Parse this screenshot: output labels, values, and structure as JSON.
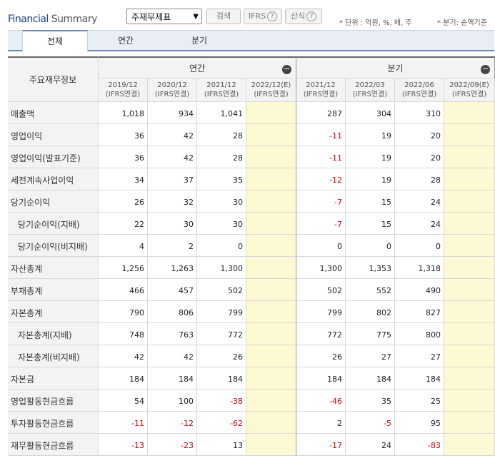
{
  "header": {
    "title_bold": "Financial",
    "title_rest": " Summary",
    "select_value": "주재무제표",
    "search_button": "검색",
    "ifrs_button": "IFRS",
    "formula_button": "산식",
    "unit_text": "* 단위 : 억원, %, 배, 주",
    "quarter_text": "* 분기: 순액기준"
  },
  "tabs": [
    "전체",
    "연간",
    "분기"
  ],
  "table": {
    "row_header": "주요재무정보",
    "annual_group": "연간",
    "quarter_group": "분기",
    "columns": [
      {
        "period": "2019/12",
        "basis": "(IFRS연결)"
      },
      {
        "period": "2020/12",
        "basis": "(IFRS연결)"
      },
      {
        "period": "2021/12",
        "basis": "(IFRS연결)"
      },
      {
        "period": "2022/12(E)",
        "basis": "(IFRS연결)"
      },
      {
        "period": "2021/12",
        "basis": "(IFRS연결)"
      },
      {
        "period": "2022/03",
        "basis": "(IFRS연결)"
      },
      {
        "period": "2022/06",
        "basis": "(IFRS연결)"
      },
      {
        "period": "2022/09(E)",
        "basis": "(IFRS연결)"
      }
    ],
    "rows": [
      {
        "label": "매출액",
        "indent": false,
        "values": [
          "1,018",
          "934",
          "1,041",
          "",
          "287",
          "304",
          "310",
          ""
        ]
      },
      {
        "label": "영업이익",
        "indent": false,
        "values": [
          "36",
          "42",
          "28",
          "",
          "-11",
          "19",
          "20",
          ""
        ]
      },
      {
        "label": "영업이익(발표기준)",
        "indent": false,
        "values": [
          "36",
          "42",
          "28",
          "",
          "-11",
          "19",
          "20",
          ""
        ]
      },
      {
        "label": "세전계속사업이익",
        "indent": false,
        "values": [
          "34",
          "37",
          "35",
          "",
          "-12",
          "19",
          "28",
          ""
        ]
      },
      {
        "label": "당기순이익",
        "indent": false,
        "values": [
          "26",
          "32",
          "30",
          "",
          "-7",
          "15",
          "24",
          ""
        ]
      },
      {
        "label": "당기순이익(지배)",
        "indent": true,
        "values": [
          "22",
          "30",
          "30",
          "",
          "-7",
          "15",
          "24",
          ""
        ]
      },
      {
        "label": "당기순이익(비지배)",
        "indent": true,
        "values": [
          "4",
          "2",
          "0",
          "",
          "0",
          "0",
          "0",
          ""
        ]
      },
      {
        "label": "자산총계",
        "indent": false,
        "values": [
          "1,256",
          "1,263",
          "1,300",
          "",
          "1,300",
          "1,353",
          "1,318",
          ""
        ]
      },
      {
        "label": "부채총계",
        "indent": false,
        "values": [
          "466",
          "457",
          "502",
          "",
          "502",
          "552",
          "490",
          ""
        ]
      },
      {
        "label": "자본총계",
        "indent": false,
        "values": [
          "790",
          "806",
          "799",
          "",
          "799",
          "802",
          "827",
          ""
        ]
      },
      {
        "label": "자본총계(지배)",
        "indent": true,
        "values": [
          "748",
          "763",
          "772",
          "",
          "772",
          "775",
          "800",
          ""
        ]
      },
      {
        "label": "자본총계(비지배)",
        "indent": true,
        "values": [
          "42",
          "42",
          "26",
          "",
          "26",
          "27",
          "27",
          ""
        ]
      },
      {
        "label": "자본금",
        "indent": false,
        "values": [
          "184",
          "184",
          "184",
          "",
          "184",
          "184",
          "184",
          ""
        ]
      },
      {
        "label": "영업활동현금흐름",
        "indent": false,
        "values": [
          "54",
          "100",
          "-38",
          "",
          "-46",
          "35",
          "25",
          ""
        ]
      },
      {
        "label": "투자활동현금흐름",
        "indent": false,
        "values": [
          "-11",
          "-12",
          "-62",
          "",
          "2",
          "-5",
          "95",
          ""
        ]
      },
      {
        "label": "재무활동현금흐름",
        "indent": false,
        "values": [
          "-13",
          "-23",
          "13",
          "",
          "-17",
          "24",
          "-83",
          ""
        ]
      }
    ]
  },
  "colors": {
    "negative": "#d8000c",
    "estimate_bg": "#fdf9d2",
    "label_bg": "#f3f3f3",
    "highlight": "#e0141e"
  }
}
